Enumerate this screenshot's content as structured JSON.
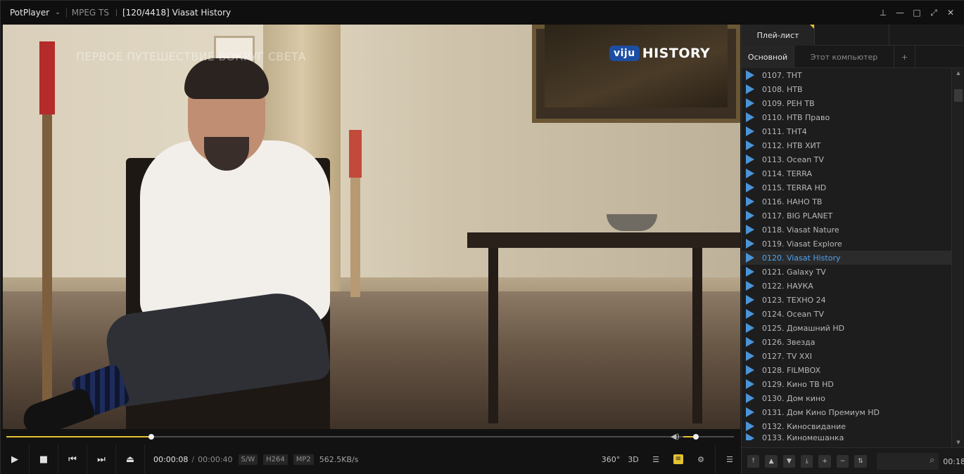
{
  "titlebar": {
    "app_name": "PotPlayer",
    "format": "MPEG TS",
    "title": "[120/4418] Viasat History"
  },
  "video": {
    "caption": "ПЕРВОЕ ПУТЕШЕСТВИЕ ВОКРУГ СВЕТА",
    "logo_badge": "viju",
    "logo_text": "HISTORY"
  },
  "seek": {
    "progress": 0.2,
    "volume": 0.25
  },
  "controls": {
    "time_current": "00:00:08",
    "time_total": "00:00:40",
    "badge_sw": "S/W",
    "badge_video": "H264",
    "badge_audio": "MP2",
    "bitrate": "562.5KB/s",
    "btn_360": "360°",
    "btn_3d": "3D"
  },
  "panel": {
    "tab_playlist": "Плей-лист",
    "subtab_main": "Основной",
    "subtab_computer": "Этот компьютер",
    "subtab_plus": "+",
    "time": "00:18",
    "items": [
      "0107. ТНТ",
      "0108. НТВ",
      "0109. РЕН ТВ",
      "0110. НТВ Право",
      "0111. ТНТ4",
      "0112. НТВ ХИТ",
      "0113. Ocean TV",
      "0114. TERRA",
      "0115. TERRA HD",
      "0116. НАНО ТВ",
      "0117. BIG PLANET",
      "0118. Viasat Nature",
      "0119. Viasat Explore",
      "0120. Viasat History",
      "0121. Galaxy TV",
      "0122. НАУКА",
      "0123. ТЕХНО 24",
      "0124. Ocean TV",
      "0125. Домашний HD",
      "0126. Звезда",
      "0127. TV XXI",
      "0128. FILMBOX",
      "0129. Кино ТВ HD",
      "0130. Дом кино",
      "0131. Дом Кино Премиум HD",
      "0132. Киносвидание",
      "0133. Киномешанка"
    ],
    "active_index": 13
  },
  "colors": {
    "accent": "#e3c22f",
    "link": "#4ea3f1",
    "play_icon": "#4a94d8"
  }
}
